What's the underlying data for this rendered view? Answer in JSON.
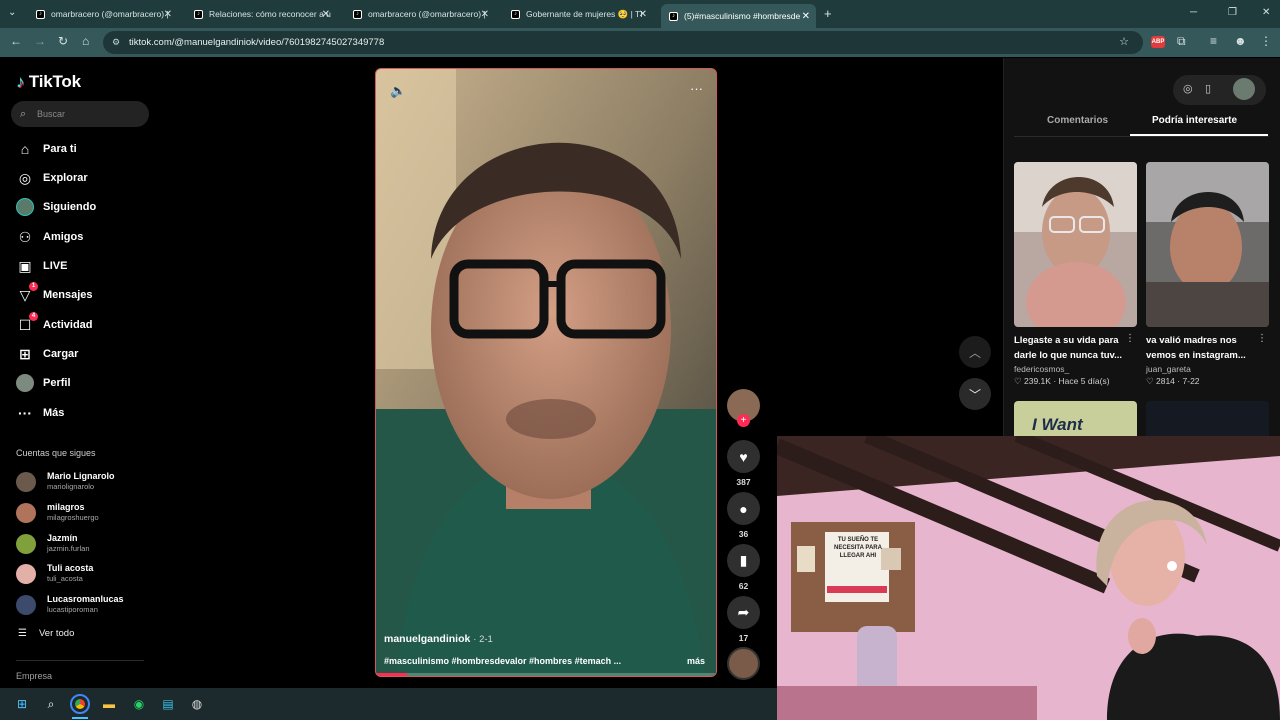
{
  "browser": {
    "tabs": [
      {
        "title": "omarbracero (@omarbracero) |"
      },
      {
        "title": "Relaciones: cómo reconocer a u"
      },
      {
        "title": "omarbracero (@omarbracero) |"
      },
      {
        "title": "Gobernante de mujeres 🥺 | TI"
      },
      {
        "title": "(5)#masculinismo #hombresde"
      }
    ],
    "url": "tiktok.com/@manuelgandiniok/video/7601982745027349778",
    "new_tab": "+"
  },
  "sidebar": {
    "logo": "TikTok",
    "search_placeholder": "Buscar",
    "nav": [
      {
        "label": "Para ti",
        "icon": "home-icon"
      },
      {
        "label": "Explorar",
        "icon": "compass-icon"
      },
      {
        "label": "Siguiendo",
        "icon": "following-avatar-icon"
      },
      {
        "label": "Amigos",
        "icon": "friends-icon"
      },
      {
        "label": "LIVE",
        "icon": "live-icon"
      },
      {
        "label": "Mensajes",
        "icon": "messages-icon",
        "badge": "1"
      },
      {
        "label": "Actividad",
        "icon": "activity-icon",
        "badge": "4"
      },
      {
        "label": "Cargar",
        "icon": "upload-icon"
      },
      {
        "label": "Perfil",
        "icon": "profile-avatar-icon"
      },
      {
        "label": "Más",
        "icon": "more-icon"
      }
    ],
    "following_title": "Cuentas que sigues",
    "accounts": [
      {
        "name": "Mario Lignarolo",
        "user": "mariolignarolo",
        "color": "#6b5a4c"
      },
      {
        "name": "milagros",
        "user": "milagroshuergo",
        "color": "#b0745c"
      },
      {
        "name": "Jazmín",
        "user": "jazmin.furlan",
        "color": "#7fa03b"
      },
      {
        "name": "Tuli acosta",
        "user": "tuli_acosta",
        "color": "#e3b0a8"
      },
      {
        "name": "Lucasromanlucas",
        "user": "lucastiporoman",
        "color": "#3c4a6b"
      }
    ],
    "see_all": "Ver todo",
    "company": "Empresa"
  },
  "video": {
    "author": "manuelgandiniok",
    "date": "· 2-1",
    "caption": "#masculinismo #hombresdevalor #hombres #temach ...",
    "more": "más",
    "progress": 0.09,
    "actions": {
      "likes": "387",
      "comments": "36",
      "saves": "62",
      "shares": "17"
    }
  },
  "right_panel": {
    "tab_comments": "Comentarios",
    "tab_suggested": "Podría interesarte",
    "cards": [
      {
        "title": "Llegaste a su vida para darle lo que nunca tuv...",
        "author": "federicosmos_",
        "likes": "239.1K",
        "time": "Hace 5 día(s)"
      },
      {
        "title": "va valió madres nos vemos en instagram...",
        "author": "juan_gareta",
        "likes": "2814",
        "time": "7-22"
      }
    ],
    "next_card_text": "I Want"
  },
  "webcam": {
    "poster_text": "TU SUEÑO TE NECESITA PARA LLEGAR AHI"
  },
  "colors": {
    "accent": "#fe2c55",
    "chrome": "#35595a",
    "video_border": "#d45a57"
  }
}
